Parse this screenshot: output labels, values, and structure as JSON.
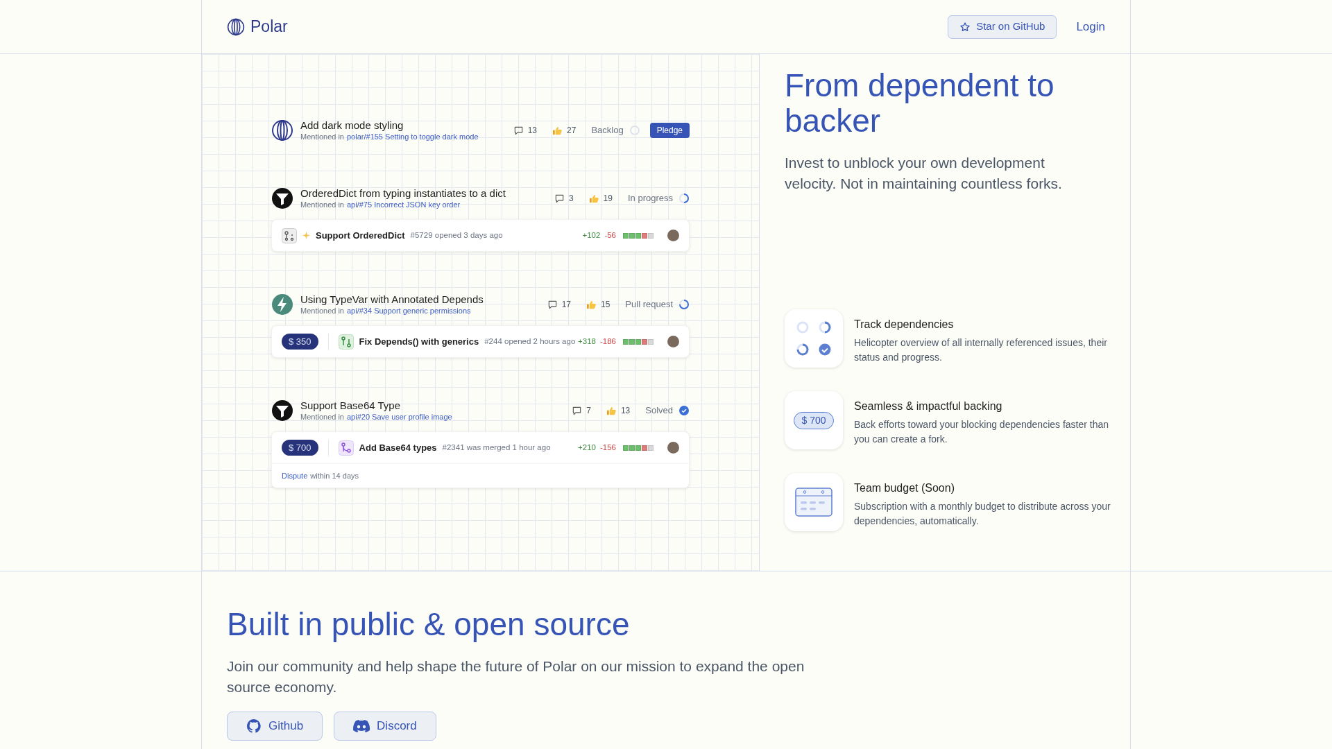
{
  "header": {
    "logo_text": "Polar",
    "star_button": "Star on GitHub",
    "login": "Login"
  },
  "issues": [
    {
      "kind": "polar",
      "title": "Add dark mode styling",
      "mention_prefix": "Mentioned in",
      "mention_link": "polar/#155 Setting to toggle dark mode",
      "comments": "13",
      "thumbs": "27",
      "status": {
        "label": "Backlog",
        "kind": "backlog"
      },
      "pledge_button": "Pledge"
    },
    {
      "kind": "funnel",
      "title": "OrderedDict from typing instantiates to a dict",
      "mention_prefix": "Mentioned in",
      "mention_link": "api/#75 Incorrect JSON key order",
      "comments": "3",
      "thumbs": "19",
      "status": {
        "label": "In progress",
        "kind": "in_progress"
      },
      "pull_request": {
        "kind": "draft",
        "sparkle": true,
        "title": "Support OrderedDict",
        "meta": "#5729 opened 3 days ago",
        "additions": "+102",
        "deletions": "-56"
      }
    },
    {
      "kind": "bolt",
      "title": "Using TypeVar with Annotated Depends",
      "mention_prefix": "Mentioned in",
      "mention_link": "api/#34 Support generic permissions",
      "comments": "17",
      "thumbs": "15",
      "status": {
        "label": "Pull request",
        "kind": "pull_request"
      },
      "pull_request": {
        "amount": "$ 350",
        "kind": "open",
        "sparkle": false,
        "title": "Fix Depends() with generics",
        "meta": "#244 opened 2 hours ago",
        "additions": "+318",
        "deletions": "-186"
      }
    },
    {
      "kind": "funnel",
      "title": "Support Base64 Type",
      "mention_prefix": "Mentioned in",
      "mention_link": "api#20 Save user profile image",
      "comments": "7",
      "thumbs": "13",
      "status": {
        "label": "Solved",
        "kind": "solved"
      },
      "pull_request": {
        "amount": "$ 700",
        "kind": "merged",
        "sparkle": false,
        "title": "Add Base64 types",
        "meta": "#2341 was merged 1 hour ago",
        "additions": "+210",
        "deletions": "-156"
      },
      "footer": {
        "link": "Dispute",
        "text": "within 14 days"
      }
    }
  ],
  "hero": {
    "title": "From dependent to backer",
    "subtitle": "Invest to unblock your own development velocity. Not in maintaining countless forks."
  },
  "features": [
    {
      "kind": "statuses",
      "title": "Track dependencies",
      "description": "Helicopter overview of all internally referenced issues, their status and progress."
    },
    {
      "kind": "amount",
      "amount": "$ 700",
      "title": "Seamless & impactful backing",
      "description": "Back efforts toward your blocking dependencies faster than you can create a fork."
    },
    {
      "kind": "budget",
      "title": "Team budget (Soon)",
      "description": "Subscription with a monthly budget to distribute across your dependencies, automatically."
    }
  ],
  "open_source": {
    "title": "Built in public & open source",
    "text": "Join our community and help shape the future of Polar on our mission to expand the open source economy.",
    "buttons": [
      {
        "kind": "github",
        "label": "Github"
      },
      {
        "kind": "discord",
        "label": "Discord"
      }
    ]
  }
}
